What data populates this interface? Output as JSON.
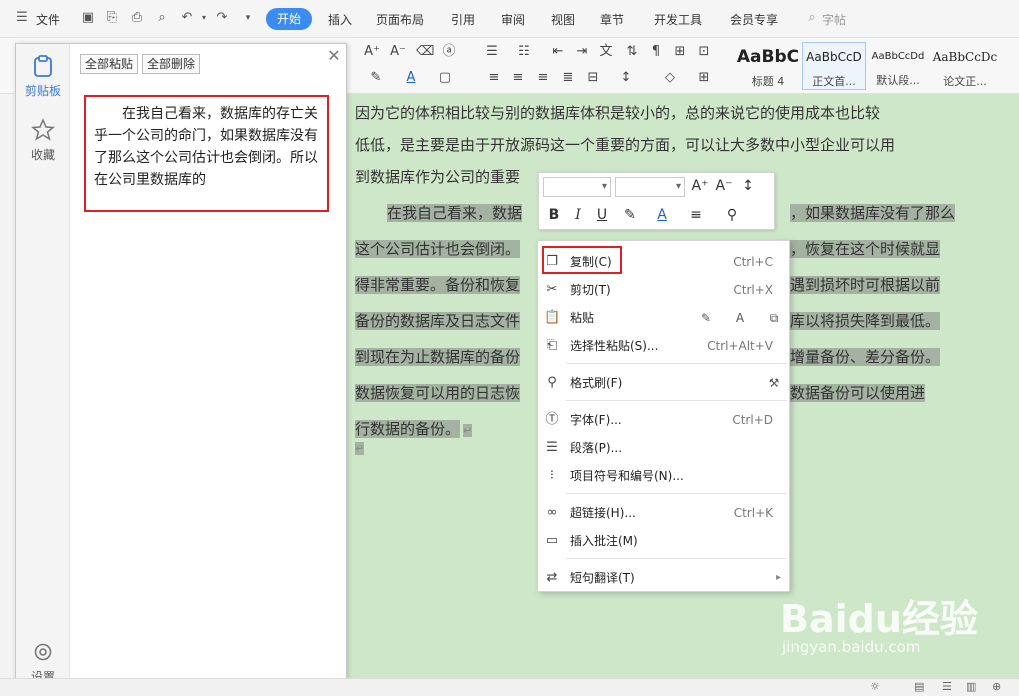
{
  "menubar": {
    "file_label": "文件",
    "tabs": [
      "开始",
      "插入",
      "页面布局",
      "引用",
      "审阅",
      "视图",
      "章节",
      "开发工具",
      "会员专享"
    ],
    "search_label": "字帖"
  },
  "ribbon": {
    "styles": [
      {
        "preview": "AaBbC",
        "name": "标题 4"
      },
      {
        "preview": "AaBbCcD",
        "name": "正文首..."
      },
      {
        "preview": "AaBbCcDd",
        "name": "默认段..."
      },
      {
        "preview": "AaBbCcDc",
        "name": "论文正..."
      }
    ]
  },
  "document": {
    "lines": [
      "因为它的体积相比较与别的数据库体积是较小的，总的来说它的使用成本也比较",
      "低低，是主要是由于开放源码这一个重要的方面，可以让大多数中小型企业可以用",
      "到数据库作为公司的重要",
      "在我自己看来，数据",
      "这个公司估计也会倒闭。",
      "得非常重要。备份和恢复",
      "备份的数据库及日志文件",
      "到现在为止数据库的备份",
      "数据恢复可以用的日志恢",
      "行数据的备份。"
    ],
    "right_fragments": [
      "，如果数据库没有了那么",
      "，恢复在这个时候就显",
      "遇到损坏时可根据以前",
      "库以将损失降到最低。",
      "增量备份、差分备份。",
      "数据备份可以使用进"
    ]
  },
  "clipboard_pane": {
    "side_items": [
      "剪贴板",
      "收藏",
      "设置"
    ],
    "paste_all": "全部粘贴",
    "delete_all": "全部删除",
    "clip_text": "在我自己看来，数据库的存亡关乎一个公司的命门，如果数据库没有了那么这个公司估计也会倒闭。所以在公司里数据库的"
  },
  "context_menu": {
    "items": [
      {
        "label": "复制(C)",
        "shortcut": "Ctrl+C",
        "icon": "copy-icon"
      },
      {
        "label": "剪切(T)",
        "shortcut": "Ctrl+X",
        "icon": "cut-icon"
      },
      {
        "label": "粘贴",
        "shortcut": "",
        "icon": "paste-icon"
      },
      {
        "label": "选择性粘贴(S)...",
        "shortcut": "Ctrl+Alt+V",
        "icon": "paste-special-icon"
      },
      {
        "label": "格式刷(F)",
        "shortcut": "",
        "icon": "format-painter-icon"
      },
      {
        "label": "字体(F)...",
        "shortcut": "Ctrl+D",
        "icon": "font-icon"
      },
      {
        "label": "段落(P)...",
        "shortcut": "",
        "icon": "paragraph-icon"
      },
      {
        "label": "项目符号和编号(N)...",
        "shortcut": "",
        "icon": "bullets-icon"
      },
      {
        "label": "超链接(H)...",
        "shortcut": "Ctrl+K",
        "icon": "link-icon"
      },
      {
        "label": "插入批注(M)",
        "shortcut": "",
        "icon": "comment-icon"
      },
      {
        "label": "短句翻译(T)",
        "shortcut": "",
        "icon": "translate-icon"
      }
    ]
  },
  "watermark": {
    "logo": "Baidu经验",
    "url": "jingyan.baidu.com"
  },
  "colors": {
    "accent": "#3c8cf0",
    "document_bg": "#cfe7c9",
    "selection": "#a4b2a2",
    "highlight_border": "#e02020"
  }
}
